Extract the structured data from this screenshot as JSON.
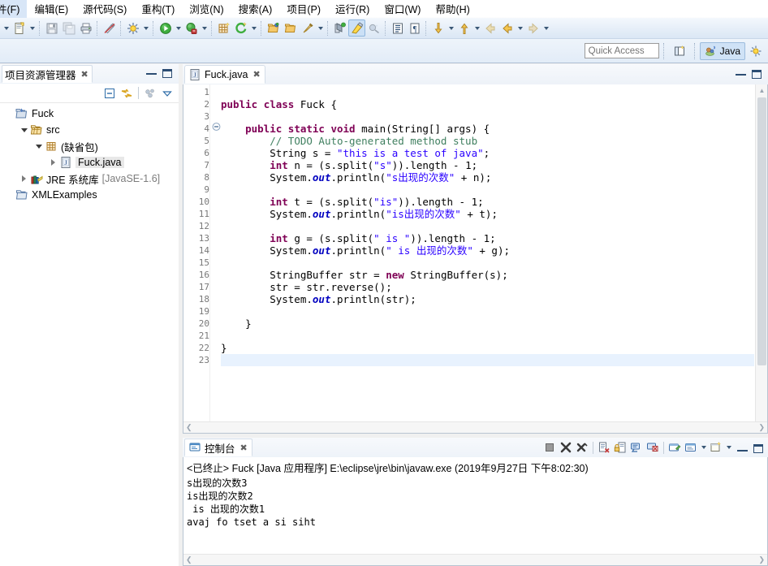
{
  "menu": {
    "items": [
      {
        "label": "件(F)"
      },
      {
        "label": "编辑(E)"
      },
      {
        "label": "源代码(S)"
      },
      {
        "label": "重构(T)"
      },
      {
        "label": "浏览(N)"
      },
      {
        "label": "搜索(A)"
      },
      {
        "label": "项目(P)"
      },
      {
        "label": "运行(R)"
      },
      {
        "label": "窗口(W)"
      },
      {
        "label": "帮助(H)"
      }
    ]
  },
  "toolbar": {
    "icons": [
      "new-wizard-icon",
      "save-icon",
      "save-all-icon",
      "print-icon",
      "toggle-mark-occurrences-icon",
      "build-icon",
      "run-icon",
      "debug-icon",
      "new-java-package-icon",
      "external-tools-icon",
      "open-type-icon",
      "open-task-icon",
      "search-icon",
      "annotation-icon",
      "outline-icon",
      "show-whitespace-icon",
      "next-annotation-icon",
      "previous-annotation-icon",
      "back-icon",
      "forward-icon"
    ]
  },
  "quick_access": {
    "placeholder": "Quick Access",
    "new-perspective_icon": "new-perspective-icon",
    "perspective": {
      "label": "Java",
      "icon": "java-perspective-icon"
    },
    "debug_perspective_icon": "debug-perspective-icon"
  },
  "project_explorer": {
    "title": "项目资源管理器",
    "close_icon": "close-icon",
    "minimize_icon": "minimize-icon",
    "maximize_icon": "maximize-icon",
    "toolbar_icons": [
      "collapse-all-icon",
      "link-with-editor-icon",
      "focus-on-active-task-icon",
      "view-menu-icon"
    ],
    "tree": [
      {
        "label": "Fuck",
        "indent": 0,
        "twist": "none",
        "icon": "java-project-icon",
        "selected": false
      },
      {
        "label": "src",
        "indent": 1,
        "twist": "down",
        "icon": "source-folder-icon",
        "selected": false
      },
      {
        "label": "(缺省包)",
        "indent": 2,
        "twist": "down",
        "icon": "package-icon",
        "selected": false
      },
      {
        "label": "Fuck.java",
        "indent": 3,
        "twist": "right",
        "icon": "java-file-icon",
        "selected": true
      },
      {
        "label": "JRE 系统库",
        "label2": "[JavaSE-1.6]",
        "indent": 1,
        "twist": "right",
        "icon": "library-icon",
        "selected": false
      },
      {
        "label": "XMLExamples",
        "indent": 0,
        "twist": "none",
        "icon": "project-closed-icon",
        "selected": false
      }
    ]
  },
  "editor": {
    "tab": {
      "label": "Fuck.java",
      "icon": "java-file-icon",
      "close_icon": "close-icon"
    },
    "minimize_icon": "minimize-icon",
    "maximize_icon": "maximize-icon",
    "line_count": 23,
    "highlight_line": 23,
    "fold_line": 4,
    "lines": [
      {
        "n": 1,
        "tokens": []
      },
      {
        "n": 2,
        "tokens": [
          {
            "t": "public ",
            "c": "kw"
          },
          {
            "t": "class ",
            "c": "kw"
          },
          {
            "t": "Fuck {",
            "c": "pl"
          }
        ]
      },
      {
        "n": 3,
        "tokens": []
      },
      {
        "n": 4,
        "tokens": [
          {
            "t": "    ",
            "c": "pl"
          },
          {
            "t": "public static void ",
            "c": "kw"
          },
          {
            "t": "main(String[] args) {",
            "c": "pl"
          }
        ]
      },
      {
        "n": 5,
        "tokens": [
          {
            "t": "        ",
            "c": "pl"
          },
          {
            "t": "// TODO Auto-generated method stub",
            "c": "cmt"
          }
        ]
      },
      {
        "n": 6,
        "tokens": [
          {
            "t": "        String s = ",
            "c": "pl"
          },
          {
            "t": "\"this is a test of java\"",
            "c": "str"
          },
          {
            "t": ";",
            "c": "pl"
          }
        ]
      },
      {
        "n": 7,
        "tokens": [
          {
            "t": "        ",
            "c": "pl"
          },
          {
            "t": "int ",
            "c": "kw"
          },
          {
            "t": "n = (s.split(",
            "c": "pl"
          },
          {
            "t": "\"s\"",
            "c": "str"
          },
          {
            "t": ")).length - ",
            "c": "pl"
          },
          {
            "t": "1",
            "c": "pl"
          },
          {
            "t": ";",
            "c": "pl"
          }
        ]
      },
      {
        "n": 8,
        "tokens": [
          {
            "t": "        System.",
            "c": "pl"
          },
          {
            "t": "out",
            "c": "fld"
          },
          {
            "t": ".println(",
            "c": "pl"
          },
          {
            "t": "\"s出现的次数\"",
            "c": "str"
          },
          {
            "t": " + n);",
            "c": "pl"
          }
        ]
      },
      {
        "n": 9,
        "tokens": []
      },
      {
        "n": 10,
        "tokens": [
          {
            "t": "        ",
            "c": "pl"
          },
          {
            "t": "int ",
            "c": "kw"
          },
          {
            "t": "t = (s.split(",
            "c": "pl"
          },
          {
            "t": "\"is\"",
            "c": "str"
          },
          {
            "t": ")).length - 1;",
            "c": "pl"
          }
        ]
      },
      {
        "n": 11,
        "tokens": [
          {
            "t": "        System.",
            "c": "pl"
          },
          {
            "t": "out",
            "c": "fld"
          },
          {
            "t": ".println(",
            "c": "pl"
          },
          {
            "t": "\"is出现的次数\"",
            "c": "str"
          },
          {
            "t": " + t);",
            "c": "pl"
          }
        ]
      },
      {
        "n": 12,
        "tokens": []
      },
      {
        "n": 13,
        "tokens": [
          {
            "t": "        ",
            "c": "pl"
          },
          {
            "t": "int ",
            "c": "kw"
          },
          {
            "t": "g = (s.split(",
            "c": "pl"
          },
          {
            "t": "\" is \"",
            "c": "str"
          },
          {
            "t": ")).length - 1;",
            "c": "pl"
          }
        ]
      },
      {
        "n": 14,
        "tokens": [
          {
            "t": "        System.",
            "c": "pl"
          },
          {
            "t": "out",
            "c": "fld"
          },
          {
            "t": ".println(",
            "c": "pl"
          },
          {
            "t": "\" is 出现的次数\"",
            "c": "str"
          },
          {
            "t": " + g);",
            "c": "pl"
          }
        ]
      },
      {
        "n": 15,
        "tokens": []
      },
      {
        "n": 16,
        "tokens": [
          {
            "t": "        StringBuffer str = ",
            "c": "pl"
          },
          {
            "t": "new ",
            "c": "kw"
          },
          {
            "t": "StringBuffer(s);",
            "c": "pl"
          }
        ]
      },
      {
        "n": 17,
        "tokens": [
          {
            "t": "        str = str.reverse();",
            "c": "pl"
          }
        ]
      },
      {
        "n": 18,
        "tokens": [
          {
            "t": "        System.",
            "c": "pl"
          },
          {
            "t": "out",
            "c": "fld"
          },
          {
            "t": ".println(str);",
            "c": "pl"
          }
        ]
      },
      {
        "n": 19,
        "tokens": []
      },
      {
        "n": 20,
        "tokens": [
          {
            "t": "    }",
            "c": "pl"
          }
        ]
      },
      {
        "n": 21,
        "tokens": []
      },
      {
        "n": 22,
        "tokens": [
          {
            "t": "}",
            "c": "pl"
          }
        ]
      },
      {
        "n": 23,
        "tokens": []
      }
    ]
  },
  "console": {
    "tab": {
      "label": "控制台",
      "icon": "console-icon",
      "close_icon": "close-icon"
    },
    "toolbar_icons": [
      "terminate-icon",
      "remove-launch-icon",
      "remove-all-terminated-icon",
      "clear-console-icon",
      "scroll-lock-icon",
      "word-wrap-icon",
      "pin-console-icon",
      "display-selected-console-icon",
      "open-console-icon",
      "minimize-icon",
      "maximize-icon"
    ],
    "launch_header": "<已终止> Fuck [Java 应用程序] E:\\eclipse\\jre\\bin\\javaw.exe (2019年9月27日 下午8:02:30)",
    "output_lines": [
      "s出现的次数3",
      "is出现的次数2",
      " is 出现的次数1",
      "avaj fo tset a si siht"
    ]
  },
  "colors": {
    "keyword": "#7f0055",
    "string": "#2a00ff",
    "comment": "#3f7f5f",
    "field": "#0000c0",
    "selection": "#e8e8e8",
    "highlight_line": "#e8f2fe",
    "toolbar_bg": "#e6eef8"
  }
}
